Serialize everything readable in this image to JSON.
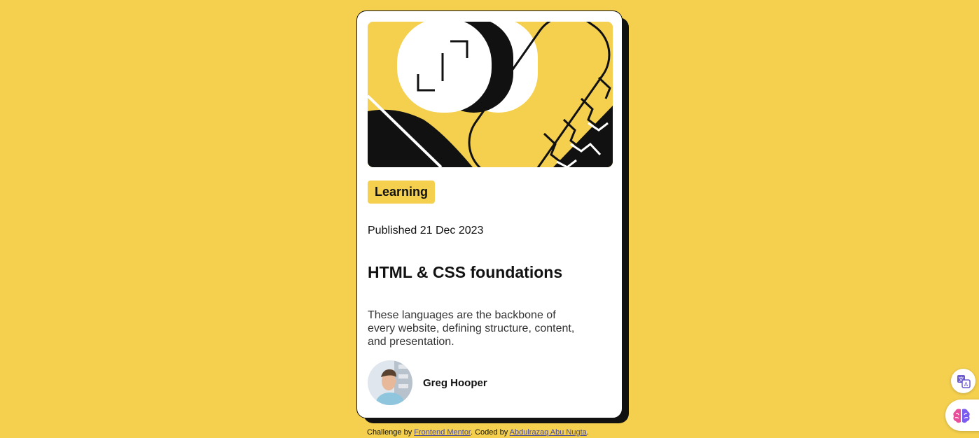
{
  "card": {
    "tag": "Learning",
    "published": "Published 21 Dec 2023",
    "title": "HTML & CSS foundations",
    "description": "These languages are the backbone of every website, defining structure, content, and presentation.",
    "author": "Greg Hooper"
  },
  "attribution": {
    "prefix": "Challenge by ",
    "challenge_link": "Frontend Mentor",
    "middle": ". Coded by ",
    "author_link": "Abdulrazaq Abu Nugta",
    "suffix": "."
  },
  "colors": {
    "background": "#F4D04E",
    "card": "#FFFFFF",
    "ink": "#111111"
  },
  "icons": {
    "translate": "translate-icon",
    "brain": "brain-icon"
  }
}
